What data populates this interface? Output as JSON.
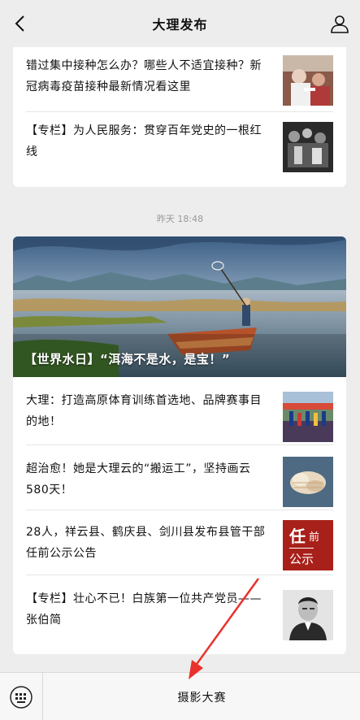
{
  "header": {
    "title": "大理发布",
    "back_icon": "chevron-left-icon",
    "profile_icon": "user-icon"
  },
  "card1": {
    "items": [
      {
        "title": "错过集中接种怎么办？哪些人不适宜接种？新冠病毒疫苗接种最新情况看这里"
      },
      {
        "title": "【专栏】为人民服务：贯穿百年党史的一根红线"
      }
    ]
  },
  "timestamp": "昨天 18:48",
  "card2": {
    "hero_caption": "【世界水日】“洱海不是水，是宝！”",
    "items": [
      {
        "title": "大理：打造高原体育训练首选地、品牌赛事目的地！"
      },
      {
        "title": "超治愈！她是大理云的“搬运工”，坚持画云580天！"
      },
      {
        "title": "28人，祥云县、鹤庆县、剑川县发布县管干部任前公示公告",
        "thumb_text_1": "任",
        "thumb_text_2": "前",
        "thumb_text_3": "公示"
      },
      {
        "title": "【专栏】壮心不已！白族第一位共产党员——张伯简"
      }
    ]
  },
  "bottom_bar": {
    "keyboard_icon": "keyboard-icon",
    "menu_label": "摄影大赛"
  },
  "colors": {
    "background": "#ededed",
    "card": "#ffffff",
    "arrow": "#e8322b",
    "notice_red": "#a8201a"
  }
}
